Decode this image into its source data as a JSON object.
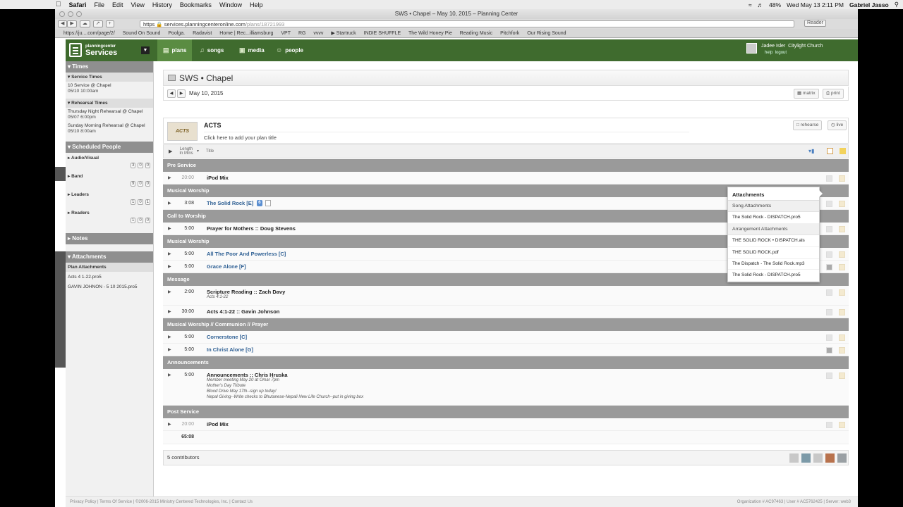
{
  "macbar": {
    "app": "Safari",
    "menus": [
      "File",
      "Edit",
      "View",
      "History",
      "Bookmarks",
      "Window",
      "Help"
    ],
    "battery": "48%",
    "datetime": "Wed May 13  2:11 PM",
    "user": "Gabriel Jasso"
  },
  "browser": {
    "tab_title": "SWS • Chapel – May 10, 2015 – Planning Center",
    "url_scheme": "https",
    "url_domain": "services.planningcenteronline.com",
    "url_path": "/plans/18721993",
    "reader": "Reader",
    "bookmarks": [
      "https://ju....com/page/2/",
      "Sound On Sound",
      "Poolga.",
      "Radavist",
      "Home | Rec...illiamsburg",
      "VPT",
      "RG",
      "vvvv",
      "▶ Startruck",
      "INDIE SHUFFLE",
      "The Wild Honey Pie",
      "Reading Music",
      "Pitchfork",
      "Our Rising Sound"
    ]
  },
  "nav": {
    "logo_small": "planningcenter",
    "logo_big": "Services",
    "tabs": [
      "plans",
      "songs",
      "media",
      "people"
    ],
    "user_name": "Jadee Isler",
    "church": "Citylight Church",
    "help": "help",
    "logout": "logout"
  },
  "sidebar": {
    "times_title": "Times",
    "service_times": "Service Times",
    "service": {
      "name": "10 Service @ Chapel",
      "time": "05/10 10:00am"
    },
    "rehearsal_times": "Rehearsal Times",
    "rehearsals": [
      {
        "name": "Thursday Night Rehearsal @ Chapel",
        "time": "05/07 6:00pm"
      },
      {
        "name": "Sunday Morning Rehearsal @ Chapel",
        "time": "05/10 8:00am"
      }
    ],
    "people_title": "Scheduled People",
    "people": [
      {
        "name": "Audio/Visual",
        "a": "3",
        "b": "0",
        "c": "0"
      },
      {
        "name": "Band",
        "a": "9",
        "b": "0",
        "c": "0"
      },
      {
        "name": "Leaders",
        "a": "1",
        "b": "0",
        "c": "1"
      },
      {
        "name": "Readers",
        "a": "1",
        "b": "0",
        "c": "0"
      }
    ],
    "notes_title": "Notes",
    "attach_title": "Attachments",
    "plan_attach": "Plan Attachments",
    "files": [
      "Acts 4 1-22.pro5",
      "GAVIN JOHNON - 5 10 2015.pro5"
    ]
  },
  "main": {
    "title": "SWS • Chapel",
    "date": "May 10, 2015",
    "matrix": "matrix",
    "print": "print",
    "plan_name": "ACTS",
    "plan_title_ph": "Click here to add your plan title",
    "thumb": "ACTS",
    "rehearse": "rehearse",
    "live": "live",
    "col_length": "Length In Mins",
    "col_title": "Title",
    "total": "65:08",
    "contributors": "5 contributors"
  },
  "sections": [
    {
      "name": "Pre Service",
      "items": [
        {
          "len": "20:00",
          "grey": true,
          "title": "iPod Mix",
          "song": false
        }
      ]
    },
    {
      "name": "Musical Worship",
      "items": [
        {
          "len": "3:08",
          "title": "The Solid Rock [E]",
          "song": true,
          "badge": "6"
        }
      ]
    },
    {
      "name": "Call to Worship",
      "items": [
        {
          "len": "5:00",
          "title": "Prayer for Mothers :: Doug Stevens",
          "song": false
        }
      ]
    },
    {
      "name": "Musical Worship",
      "items": [
        {
          "len": "5:00",
          "title": "All The Poor And Powerless [C]",
          "song": true
        },
        {
          "len": "5:00",
          "title": "Grace Alone [F]",
          "song": true
        }
      ]
    },
    {
      "name": "Message",
      "items": [
        {
          "len": "2:00",
          "title": "Scripture Reading :: Zach Davy",
          "song": false,
          "sub": [
            "Acts 4:1-22"
          ]
        },
        {
          "len": "30:00",
          "title": "Acts 4:1-22 :: Gavin Johnson",
          "song": false
        }
      ]
    },
    {
      "name": "Musical Worship // Communion // Prayer",
      "items": [
        {
          "len": "5:00",
          "title": "Cornerstone [C]",
          "song": true
        },
        {
          "len": "5:00",
          "title": "In Christ Alone [G]",
          "song": true
        }
      ]
    },
    {
      "name": "Announcements",
      "items": [
        {
          "len": "5:00",
          "title": "Announcements :: Chris Hruska",
          "song": false,
          "sub": [
            "Member meeting May 20 at Omar 7pm",
            "Mother's Day Tribute",
            "Blood Drive May 17th--sign up today!",
            "Nepal Giving--Write checks to Bhutanese-Nepali New Life Church--put in giving box"
          ]
        }
      ]
    },
    {
      "name": "Post Service",
      "items": [
        {
          "len": "20:00",
          "grey": true,
          "title": "iPod Mix",
          "song": false
        }
      ]
    }
  ],
  "popup": {
    "title": "Attachments",
    "song_header": "Song Attachments",
    "song_items": [
      "The Solid Rock - DISPATCH.pro5"
    ],
    "arr_header": "Arrangement Attachments",
    "arr_items": [
      "THE SOLID ROCK • DISPATCH.als",
      "THE SOLID ROCK.pdf",
      "The Dispatch - The Solid Rock.mp3",
      "The Solid Rock - DISPATCH.pro5"
    ]
  },
  "footer": {
    "privacy": "Privacy Policy",
    "terms": "Terms Of Service",
    "copyright": "©2006-2015 Ministry Centered Technologies, Inc.",
    "contact": "Contact Us",
    "right": "Organization # AC97463  |  User # AC5762425  |  Server: web3"
  },
  "colors": {
    "nav_green": "#3f6b2e",
    "song_blue": "#2f6094",
    "section_grey": "#9a9a9a"
  }
}
